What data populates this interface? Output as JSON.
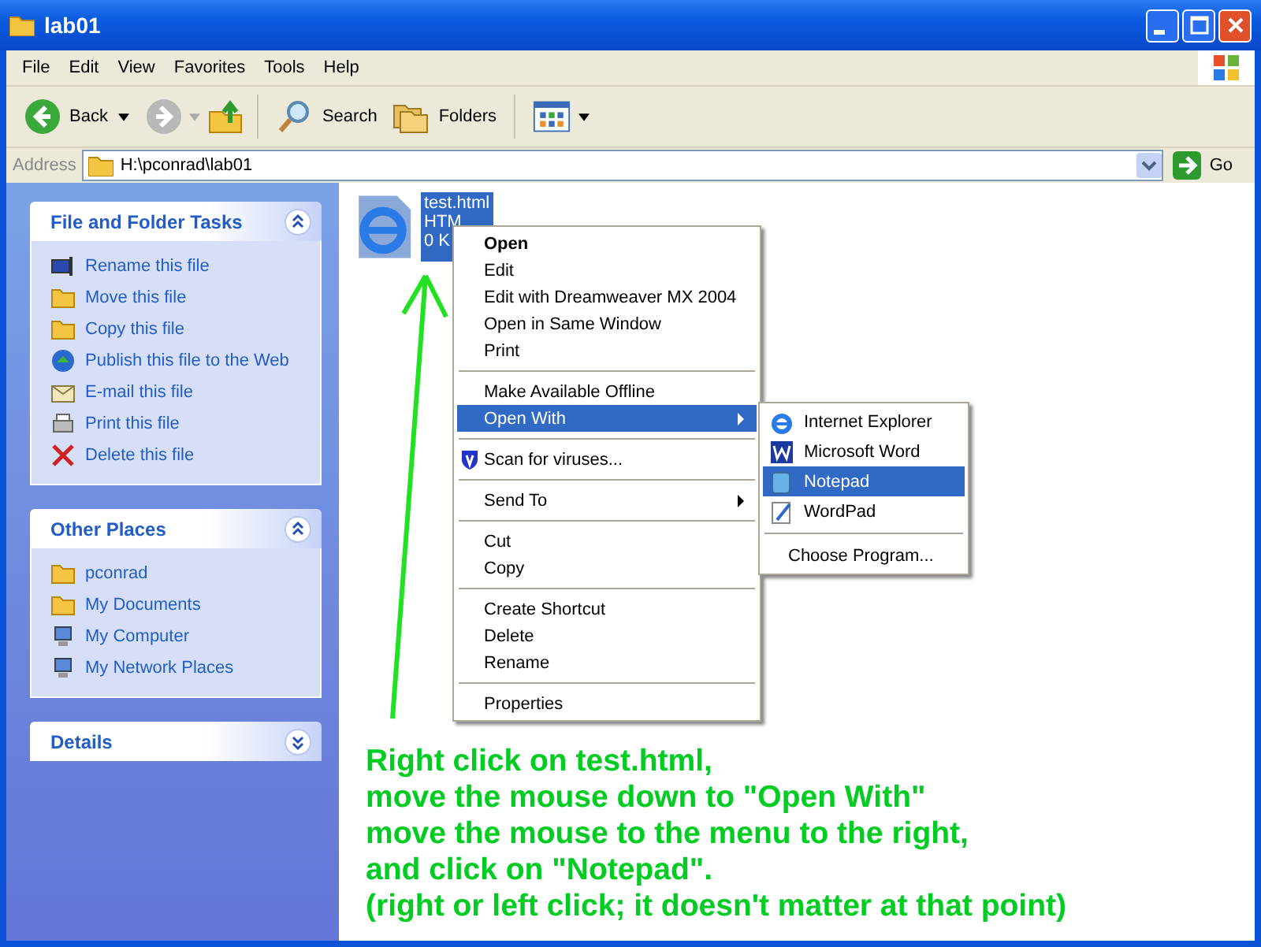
{
  "window": {
    "title": "lab01"
  },
  "menu_bar": [
    "File",
    "Edit",
    "View",
    "Favorites",
    "Tools",
    "Help"
  ],
  "toolbar": {
    "back": "Back",
    "forward_disabled": true,
    "search": "Search",
    "folders": "Folders"
  },
  "address_bar": {
    "label": "Address",
    "value": "H:\\pconrad\\lab01",
    "go": "Go"
  },
  "sidebar": [
    {
      "title": "File and Folder Tasks",
      "expanded": true,
      "items": [
        "Rename this file",
        "Move this file",
        "Copy this file",
        "Publish this file to the Web",
        "E-mail this file",
        "Print this file",
        "Delete this file"
      ]
    },
    {
      "title": "Other Places",
      "expanded": true,
      "items": [
        "pconrad",
        "My Documents",
        "My Computer",
        "My Network Places"
      ]
    },
    {
      "title": "Details",
      "expanded": false
    }
  ],
  "file": {
    "name": "test.html",
    "type": "HTM",
    "size": "0 K",
    "selected": true
  },
  "context_menu": [
    [
      {
        "label": "Open",
        "kind": "plain",
        "bold": true,
        "submenu": false,
        "selected": false
      },
      {
        "label": "Edit",
        "kind": "plain",
        "bold": false,
        "submenu": false,
        "selected": false
      },
      {
        "label": "Edit with Dreamweaver MX 2004",
        "kind": "plain",
        "bold": false,
        "submenu": false,
        "selected": false
      },
      {
        "label": "Open in Same Window",
        "kind": "plain",
        "bold": false,
        "submenu": false,
        "selected": false
      },
      {
        "label": "Print",
        "kind": "plain",
        "bold": false,
        "submenu": false,
        "selected": false
      }
    ],
    [
      {
        "label": "Make Available Offline",
        "kind": "plain",
        "bold": false,
        "submenu": false,
        "selected": false
      },
      {
        "label": "Open With",
        "kind": "plain",
        "bold": false,
        "submenu": true,
        "selected": true
      }
    ],
    [
      {
        "label": "Scan for viruses...",
        "kind": "shield",
        "bold": false,
        "submenu": false,
        "selected": false
      }
    ],
    [
      {
        "label": "Send To",
        "kind": "plain",
        "bold": false,
        "submenu": true,
        "selected": false
      }
    ],
    [
      {
        "label": "Cut",
        "kind": "plain",
        "bold": false,
        "submenu": false,
        "selected": false
      },
      {
        "label": "Copy",
        "kind": "plain",
        "bold": false,
        "submenu": false,
        "selected": false
      }
    ],
    [
      {
        "label": "Create Shortcut",
        "kind": "plain",
        "bold": false,
        "submenu": false,
        "selected": false
      },
      {
        "label": "Delete",
        "kind": "plain",
        "bold": false,
        "submenu": false,
        "selected": false
      },
      {
        "label": "Rename",
        "kind": "plain",
        "bold": false,
        "submenu": false,
        "selected": false
      }
    ],
    [
      {
        "label": "Properties",
        "kind": "plain",
        "bold": false,
        "submenu": false,
        "selected": false
      }
    ]
  ],
  "open_with_menu": [
    {
      "label": "Internet Explorer",
      "kind": "app",
      "selected": false
    },
    {
      "label": "Microsoft Word",
      "kind": "app",
      "selected": false
    },
    {
      "label": "Notepad",
      "kind": "app",
      "selected": true
    },
    {
      "label": "WordPad",
      "kind": "app",
      "selected": false
    },
    {
      "label": "Choose Program...",
      "kind": "choose",
      "selected": false
    }
  ],
  "annotation": [
    "Right click on test.html,",
    "move the mouse down to \"Open With\"",
    "move the mouse to the menu to the right,",
    "and click on \"Notepad\".",
    "(right or left click; it doesn't matter at that point)"
  ]
}
